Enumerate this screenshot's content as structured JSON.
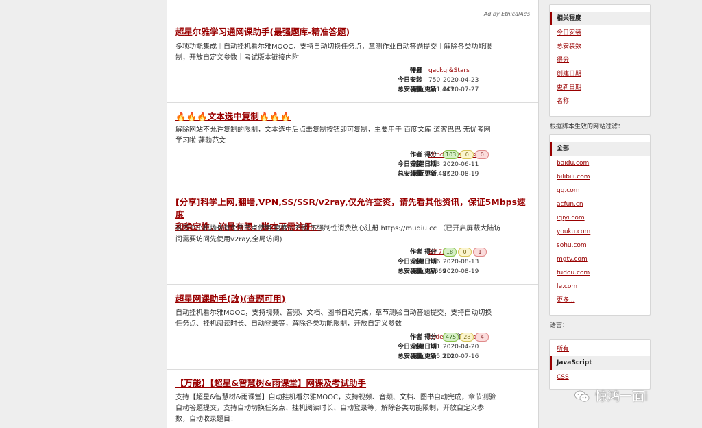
{
  "ad_label": "Ad by EthicalAds",
  "labels": {
    "author": "作者",
    "daily": "今日安装",
    "total": "总安装量",
    "score": "得分",
    "created": "创建日期",
    "updated": "最近更新"
  },
  "scripts": [
    {
      "title": "超星尔雅学习通网课助手(最强题库-精准答题)",
      "desc_lines": [
        "多项功能集成｜自动挂机看尔雅MOOC，支持自动切换任务点，章测作业自动答题提交｜解除各类功能限",
        "制，开放自定义参数｜考试版本链接内附"
      ],
      "authors": [
        "qackqi&Stars"
      ],
      "daily": "750",
      "total": "441,443",
      "score": [
        "309",
        "21",
        "5"
      ],
      "created": "2020-04-23",
      "updated": "2020-07-27"
    },
    {
      "title": "🔥🔥🔥文本选中复制🔥🔥🔥",
      "desc_lines": [
        "解除网站不允许复制的限制，文本选中后点击复制按钮即可复制，主要用于 百度文库 道客巴巴 无忧考网",
        "学习啦 蓬勃范文"
      ],
      "authors": [
        "WindrunnerMax"
      ],
      "daily": "713",
      "total": "40,487",
      "score": [
        "103",
        "0",
        "0"
      ],
      "created": "2020-06-11",
      "updated": "2020-08-19"
    },
    {
      "title_lines": [
        "[分享]科学上网,翻墙,VPN,SS/SSR/v2ray,仅允许查资，请先看其他资讯，保证5Mbps速度",
        "和稳定性，流量有限，脚本无需注册。"
      ],
      "desc_lines": [
        "这是个小机场也有免费节点使用,速度也不慢,不强制性消费放心注册 https://muqiu.cc  （已开启屏蔽大陆访",
        "问需要访问先使用v2ray,全局访问)"
      ],
      "authors": [
        "BT 7274"
      ],
      "daily": "556",
      "total": "9,669",
      "score": [
        "18",
        "0",
        "1"
      ],
      "created": "2020-08-13",
      "updated": "2020-08-19"
    },
    {
      "title": "超星网课助手(改)(查题可用)",
      "desc_lines": [
        "自动挂机看尔雅MOOC，支持视频、音频、文档、图书自动完成，章节测验自动答题提交，支持自动切换",
        "任务点、挂机阅读时长、自动登录等，解除各类功能限制，开放自定义参数"
      ],
      "authors": [
        "coder-tq",
        "nfsq"
      ],
      "author_joiner": "和",
      "daily": "361",
      "total": "495,210",
      "score": [
        "475",
        "28",
        "4"
      ],
      "created": "2020-04-20",
      "updated": "2020-07-16"
    },
    {
      "title": "【万能】【超星&智慧树&雨课堂】网课及考试助手",
      "desc_lines": [
        "支持【超星&智慧树&雨课堂】自动挂机看尔雅MOOC，支持视频、音频、文档、图书自动完成，章节测验",
        "自动答题提交，支持自动切换任务点、挂机阅读时长、自动登录等，解除各类功能限制，开放自定义参",
        "数，自动收录题目！"
      ]
    }
  ],
  "sidebar": {
    "sort": {
      "current": "相关程度",
      "links": [
        "今日安装",
        "总安装数",
        "得分",
        "创建日期",
        "更新日期",
        "名称"
      ]
    },
    "site_filter_label": "根据脚本生效的网站过滤：",
    "sites": {
      "current": "全部",
      "links": [
        "baidu.com",
        "bilibili.com",
        "qq.com",
        "acfun.cn",
        "iqiyi.com",
        "youku.com",
        "sohu.com",
        "mgtv.com",
        "tudou.com",
        "le.com",
        "更多..."
      ]
    },
    "language_label": "语言：",
    "languages": {
      "all": "所有",
      "current": "JavaScript",
      "other": "CSS"
    }
  },
  "watermark": "惊鸿一面i"
}
